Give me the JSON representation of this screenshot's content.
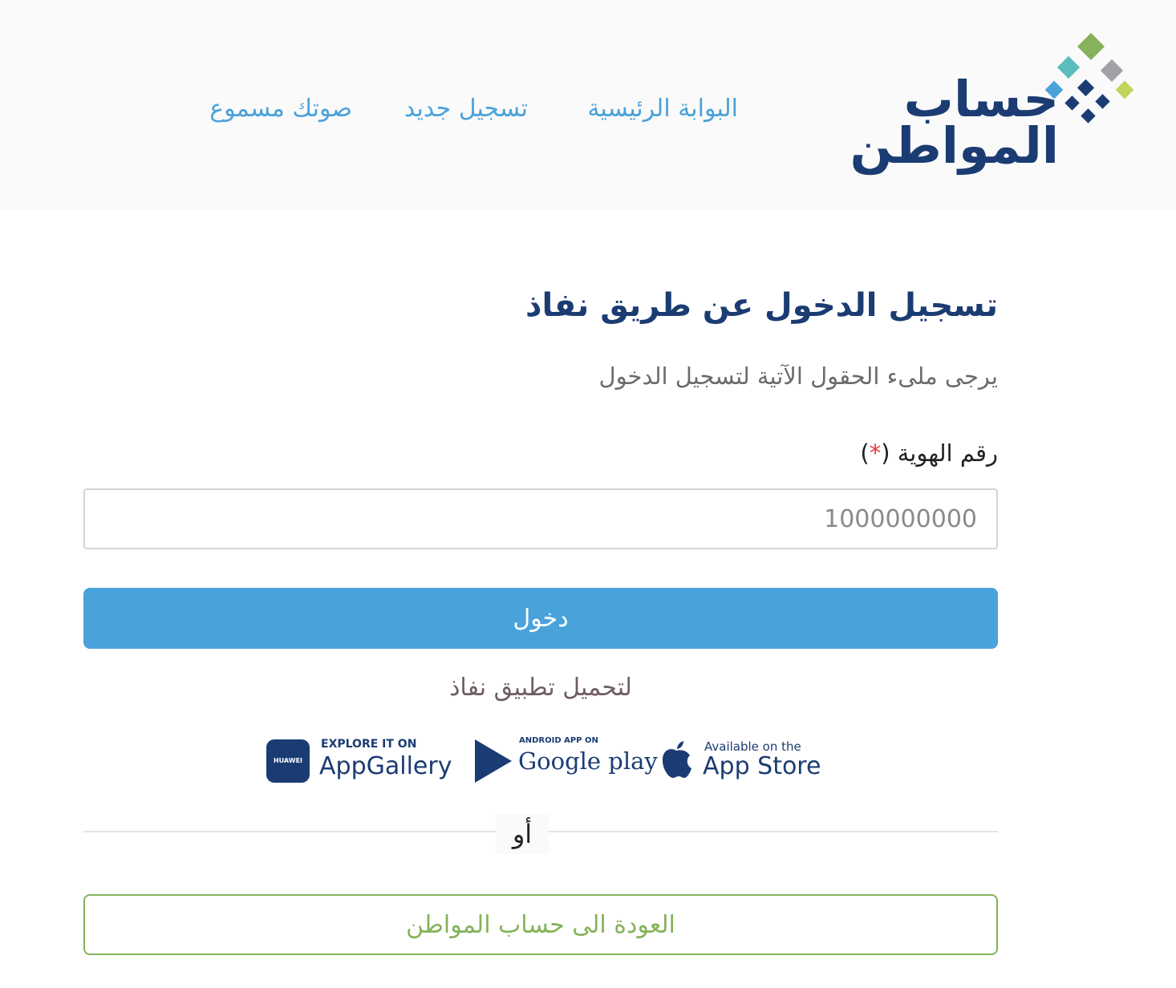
{
  "header": {
    "logo": {
      "line1": "حساب",
      "line2": "المواطن",
      "colors": {
        "navy": "#1b3c73",
        "green": "#85b25a",
        "teal": "#5bbcbd",
        "gray": "#9fa1a4",
        "lime": "#c2d35a",
        "blue": "#4aa2db"
      }
    },
    "nav": [
      {
        "label": "البوابة الرئيسية"
      },
      {
        "label": "تسجيل جديد"
      },
      {
        "label": "صوتك مسموع"
      }
    ]
  },
  "main": {
    "title": "تسجيل الدخول عن طريق نفاذ",
    "subtitle": "يرجى ملىء الحقول الآتية لتسجيل الدخول",
    "id_field": {
      "label": "رقم الهوية",
      "required_marker": "*",
      "placeholder": "1000000000",
      "value": ""
    },
    "login_button": "دخول",
    "download_label": "لتحميل تطبيق نفاذ",
    "stores": [
      {
        "icon": "huawei-appgallery-icon",
        "small": "EXPLORE IT ON",
        "big": "AppGallery",
        "badge": "HUAWEI"
      },
      {
        "icon": "google-play-icon",
        "small": "ANDROID APP ON",
        "big": "Google play"
      },
      {
        "icon": "apple-icon",
        "small": "Available on the",
        "big": "App Store"
      }
    ],
    "or_label": "أو",
    "back_button": "العودة الى حساب المواطن"
  }
}
